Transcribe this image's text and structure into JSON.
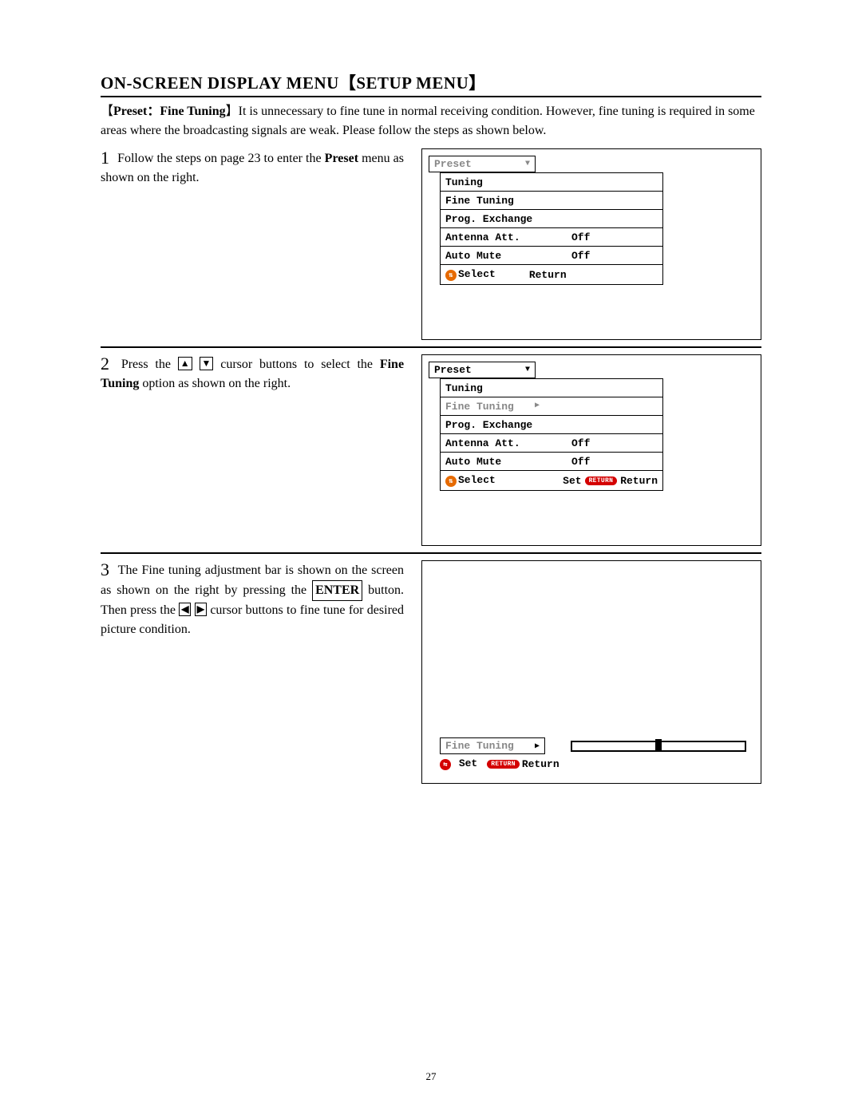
{
  "title_left": "ON-SCREEN DISPLAY MENU",
  "title_bracket": "SETUP MENU",
  "intro_bold": "Preset：Fine Tuning",
  "intro_body": "It is unnecessary to fine tune in normal receiving condition. However, fine tuning is required in some areas where the broadcasting signals are weak. Please follow the steps as shown below.",
  "pagenum": "27",
  "step1": {
    "num": "1",
    "t1": "Follow the steps on page 23 to enter the ",
    "t2": "Preset",
    "t3": " menu as shown on the right.",
    "osd_header": "Preset",
    "rows": [
      {
        "label": "Tuning"
      },
      {
        "label": "Fine Tuning"
      },
      {
        "label": "Prog. Exchange"
      },
      {
        "label": "Antenna Att.",
        "value": "Off"
      },
      {
        "label": "Auto Mute",
        "value": "Off"
      }
    ],
    "help_select": "Select",
    "help_return": "Return"
  },
  "step2": {
    "num": "2",
    "t1": "Press the ",
    "t2": " cursor buttons to select the ",
    "t3": "Fine Tuning",
    "t4": " option as shown on the right.",
    "osd_header": "Preset",
    "rows": [
      {
        "label": "Tuning"
      },
      {
        "label": "Fine Tuning",
        "dim": true,
        "arrow": true
      },
      {
        "label": "Prog. Exchange"
      },
      {
        "label": "Antenna Att.",
        "value": "Off"
      },
      {
        "label": "Auto Mute",
        "value": "Off"
      }
    ],
    "help_select": "Select",
    "help_set": "Set",
    "help_retcap": "RETURN",
    "help_return": "Return"
  },
  "step3": {
    "num": "3",
    "t1": "The Fine tuning adjustment bar is shown on the screen as shown on the right by pressing the ",
    "t2": "ENTER",
    "t3": " button. Then press the ",
    "t4": " cursor buttons to fine tune for desired picture condition.",
    "ft_label": "Fine Tuning",
    "help_set": "Set",
    "help_retcap": "RETURN",
    "help_return": "Return"
  }
}
